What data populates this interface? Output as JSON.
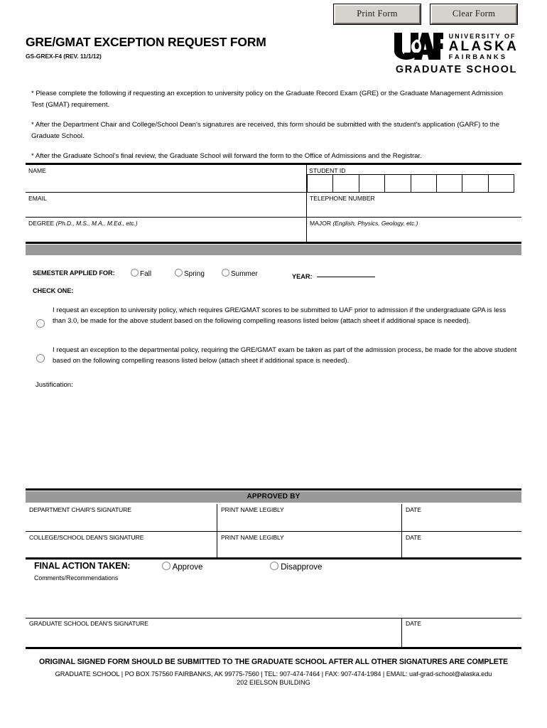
{
  "toolbar": {
    "print_label": "Print Form",
    "clear_label": "Clear Form"
  },
  "header": {
    "title": "GRE/GMAT EXCEPTION REQUEST FORM",
    "form_number": "GS-GREX-F4 (REV. 11/1/12)",
    "logo": {
      "mark": "UAF",
      "line1": "UNIVERSITY OF",
      "line2": "ALASKA",
      "line3": "FAIRBANKS",
      "unit": "GRADUATE SCHOOL"
    }
  },
  "intro": {
    "paragraphs": [
      "* Please complete the following if requesting an exception to university policy on the Graduate Record Exam (GRE) or the Graduate Management Admission Test (GMAT) requirement.",
      "* After the Department Chair and College/School Dean's signatures are received, this form should be submitted with the student's application (GARF) to the Graduate School.",
      "* After the Graduate School's final review, the Graduate School will forward the form to the Office of Admissions and the Registrar."
    ]
  },
  "info_table": {
    "name_label": "NAME",
    "student_id_label": "STUDENT ID",
    "student_id_box_count": 8,
    "email_label": "EMAIL",
    "telephone_label": "TELEPHONE NUMBER",
    "degree_label": "DEGREE",
    "degree_hint": "(Ph.D., M.S., M.A., M.Ed., etc.)",
    "major_label": "MAJOR",
    "major_hint": "(English, Physics, Geology, etc.)"
  },
  "semester": {
    "label": "SEMESTER APPLIED FOR:",
    "options": [
      "Fall",
      "Spring",
      "Summer"
    ],
    "year_label": "YEAR:",
    "year_value": ""
  },
  "check_one": {
    "heading": "CHECK ONE:",
    "options": [
      "I request an exception to university policy, which requires GRE/GMAT scores to be submitted to UAF prior to admission if the undergraduate GPA is less than 3.0, be made for the above student based on the following compelling reasons listed below (attach sheet if additional space is needed).",
      "I request an exception to the departmental policy, requiring the GRE/GMAT exam be taken as part of the admission process, be made for the above student based on the following compelling reasons listed below (attach sheet if additional space is needed)."
    ]
  },
  "justification": {
    "label": "Justification:",
    "value": ""
  },
  "approved_by": {
    "heading": "APPROVED BY",
    "rows": [
      {
        "signature_label": "DEPARTMENT CHAIR'S SIGNATURE",
        "print_name_label": "PRINT NAME LEGIBLY",
        "date_label": "DATE"
      },
      {
        "signature_label": "COLLEGE/SCHOOL DEAN'S SIGNATURE",
        "print_name_label": "PRINT NAME LEGIBLY",
        "date_label": "DATE"
      }
    ]
  },
  "final_action": {
    "label": "FINAL ACTION TAKEN:",
    "options": [
      "Approve",
      "Disapprove"
    ],
    "comments_label": "Comments/Recommendations"
  },
  "grad_dean": {
    "signature_label": "GRADUATE SCHOOL DEAN'S SIGNATURE",
    "date_label": "DATE"
  },
  "footer": {
    "notice": "ORIGINAL SIGNED FORM SHOULD BE SUBMITTED TO THE GRADUATE SCHOOL AFTER ALL OTHER SIGNATURES ARE COMPLETE",
    "contact": "GRADUATE SCHOOL  |  PO BOX 757560  FAIRBANKS, AK 99775-7560  |  TEL: 907-474-7464  |  FAX: 907-474-1984  |  EMAIL: uaf-grad-school@alaska.edu",
    "address": "202 EIELSON BUILDING"
  }
}
